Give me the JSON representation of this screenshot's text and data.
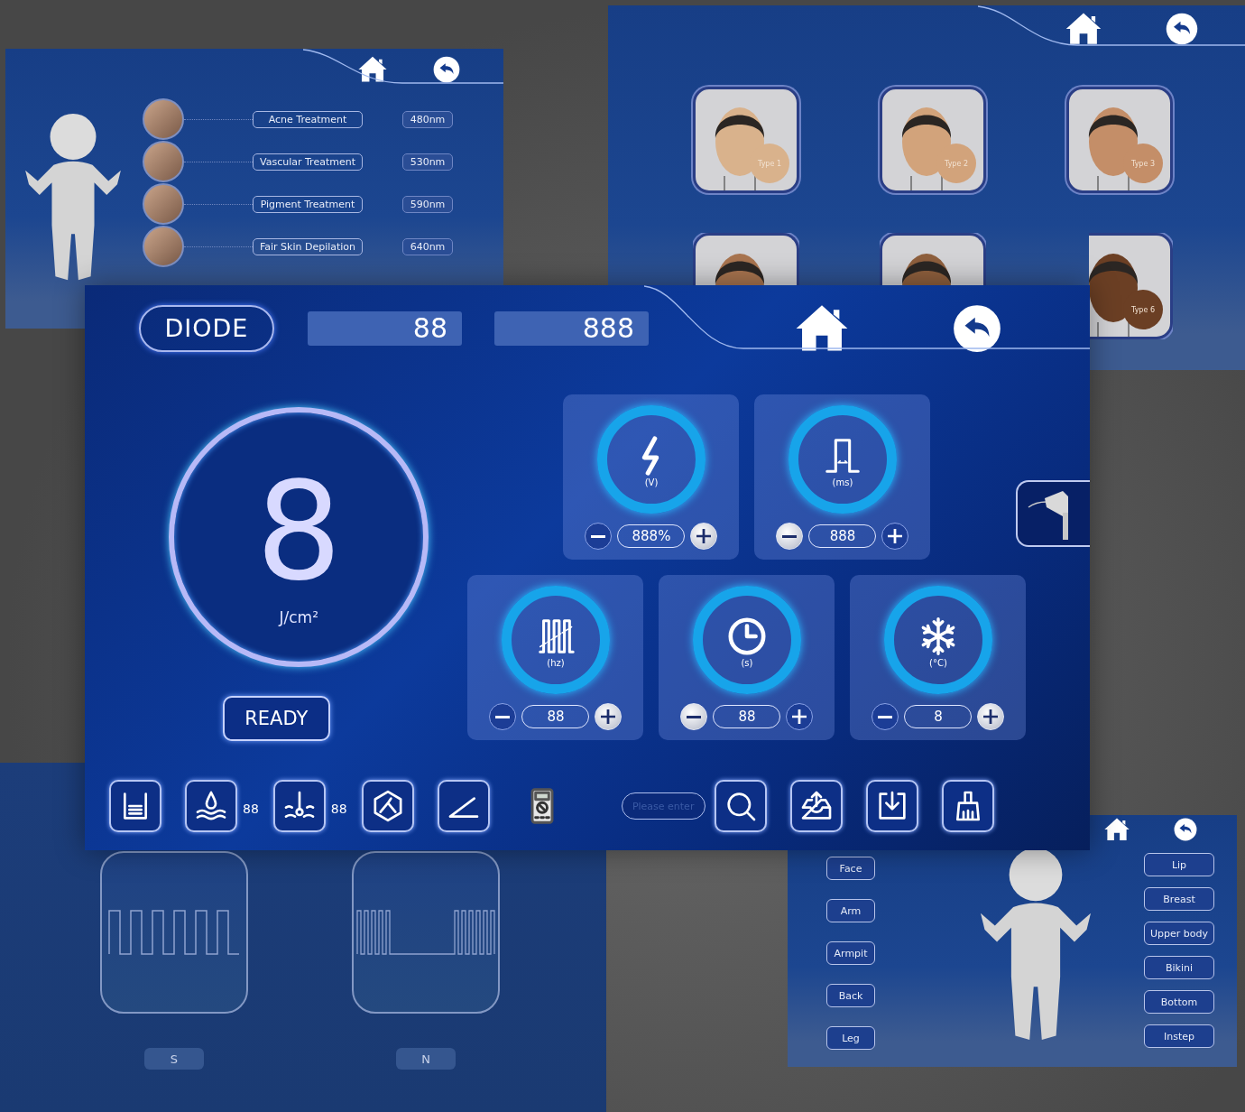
{
  "treatment_screen": {
    "treatments": [
      {
        "name": "Acne Treatment",
        "wavelength": "480nm"
      },
      {
        "name": "Vascular Treatment",
        "wavelength": "530nm"
      },
      {
        "name": "Pigment Treatment",
        "wavelength": "590nm"
      },
      {
        "name": "Fair Skin Depilation",
        "wavelength": "640nm"
      }
    ]
  },
  "skin_type_screen": {
    "skin_types": [
      {
        "label": "Type 1",
        "color": "#d9b28c"
      },
      {
        "label": "Type 2",
        "color": "#d2a37b"
      },
      {
        "label": "Type 3",
        "color": "#c48e68"
      },
      {
        "color": "#a8744f"
      },
      {
        "color": "#8e5f3d"
      },
      {
        "label": "Type 6",
        "color": "#6b3f24"
      }
    ]
  },
  "pulse_mode_screen": {
    "modes": [
      {
        "label": "S"
      },
      {
        "label": "N"
      }
    ]
  },
  "body_area_screen": {
    "left_areas": [
      "Face",
      "Arm",
      "Armpit",
      "Back",
      "Leg"
    ],
    "right_areas": [
      "Lip",
      "Breast",
      "Upper body",
      "Bikini",
      "Bottom",
      "Instep"
    ]
  },
  "main_screen": {
    "mode": "DIODE",
    "readout_1": "88",
    "readout_2": "888",
    "fluence": {
      "value": "8",
      "unit": "J/cm²"
    },
    "ready_button": "READY",
    "parameters": [
      {
        "unit": "(V)",
        "value": "888%",
        "minus_lit": false,
        "plus_lit": true
      },
      {
        "unit": "(ms)",
        "value": "888",
        "minus_lit": true,
        "plus_lit": false
      },
      {
        "unit": "(hz)",
        "value": "88",
        "minus_lit": false,
        "plus_lit": true
      },
      {
        "unit": "(s)",
        "value": "88",
        "minus_lit": true,
        "plus_lit": false
      },
      {
        "unit": "(°C)",
        "value": "8",
        "minus_lit": false,
        "plus_lit": true
      }
    ],
    "toolbar": [
      {
        "kind": "button"
      },
      {
        "kind": "button",
        "reading": "88"
      },
      {
        "kind": "button",
        "reading": "88"
      },
      {
        "kind": "button"
      },
      {
        "kind": "button"
      },
      {
        "kind": "device"
      },
      {
        "kind": "field",
        "placeholder": "Please enter"
      },
      {
        "kind": "button"
      },
      {
        "kind": "button"
      },
      {
        "kind": "button"
      },
      {
        "kind": "button"
      }
    ]
  }
}
